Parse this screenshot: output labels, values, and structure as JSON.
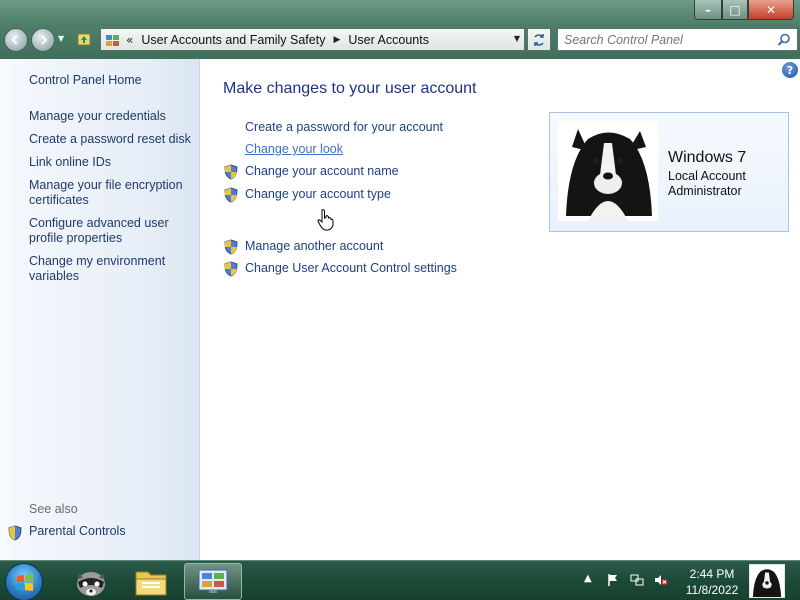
{
  "window": {
    "minimize_glyph": "–",
    "maximize_glyph": "□",
    "close_glyph": "✕"
  },
  "nav": {
    "back_icon": "arrow-left-icon",
    "forward_icon": "arrow-right-icon"
  },
  "address": {
    "more_glyph": "«",
    "crumbs": [
      "User Accounts and Family Safety",
      "User Accounts"
    ],
    "separator_glyph": "▶"
  },
  "search": {
    "placeholder": "Search Control Panel"
  },
  "help": {
    "glyph": "?"
  },
  "sidebar": {
    "items": [
      "Control Panel Home",
      "Manage your credentials",
      "Create a password reset disk",
      "Link online IDs",
      "Manage your file encryption certificates",
      "Configure advanced user profile properties",
      "Change my environment variables"
    ],
    "see_also": "See also",
    "parental": "Parental Controls"
  },
  "main": {
    "title": "Make changes to your user account",
    "tasks": [
      "Create a password for your account",
      "Change your look",
      "Change your account name",
      "Change your account type",
      "Manage another account",
      "Change User Account Control settings"
    ]
  },
  "account": {
    "name": "Windows 7",
    "type": "Local Account",
    "role": "Administrator"
  },
  "taskbar": {
    "time": "2:44 PM",
    "date": "11/8/2022",
    "tray_chevron": "▲"
  },
  "colors": {
    "link": "#1e3f86",
    "title": "#1e3287",
    "glass": "#4f7f6a"
  }
}
